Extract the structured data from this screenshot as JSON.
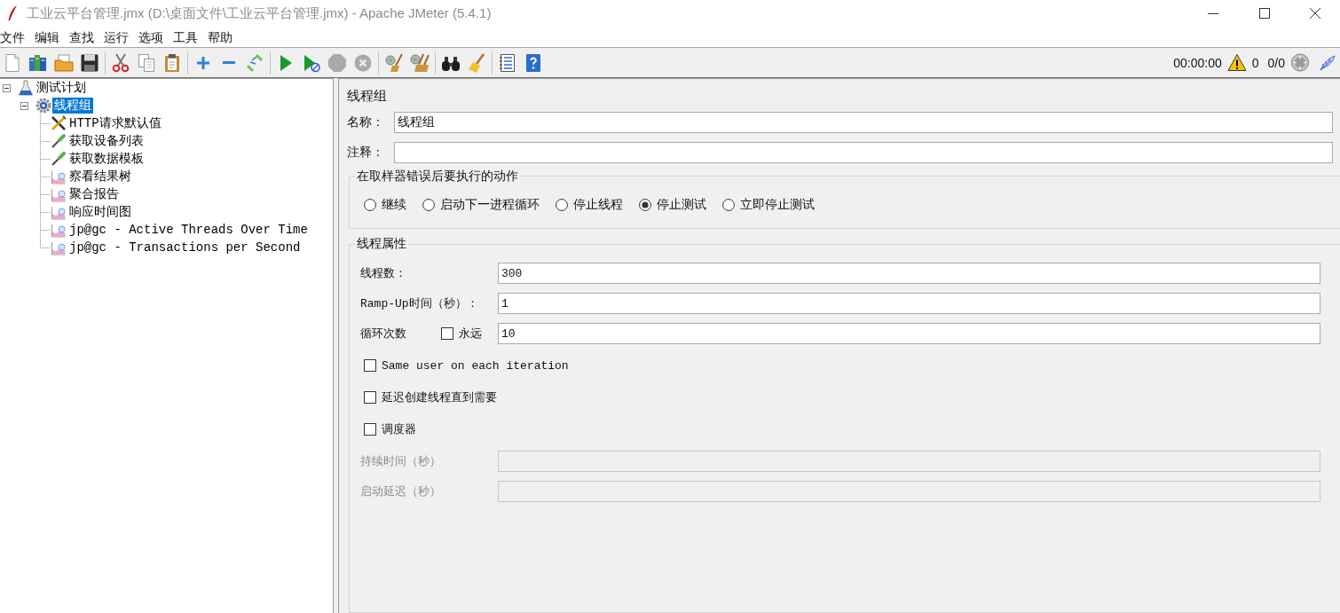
{
  "window": {
    "title": "工业云平台管理.jmx (D:\\桌面文件\\工业云平台管理.jmx) - Apache JMeter (5.4.1)"
  },
  "menu": [
    "文件",
    "编辑",
    "查找",
    "运行",
    "选项",
    "工具",
    "帮助"
  ],
  "toolbar": {
    "stop_disabled": true
  },
  "status": {
    "elapsed": "00:00:00",
    "errors": "0",
    "threads": "0/0"
  },
  "tree": [
    {
      "label": "测试计划",
      "kind": "plan",
      "expanded": true,
      "selected": false,
      "children": [
        {
          "label": "线程组",
          "kind": "thread_group",
          "expanded": true,
          "selected": true,
          "children": [
            {
              "label": "HTTP请求默认值",
              "kind": "config",
              "selected": false
            },
            {
              "label": "获取设备列表",
              "kind": "sampler",
              "selected": false
            },
            {
              "label": "获取数据模板",
              "kind": "sampler",
              "selected": false
            },
            {
              "label": "察看结果树",
              "kind": "listener",
              "selected": false
            },
            {
              "label": "聚合报告",
              "kind": "listener",
              "selected": false
            },
            {
              "label": "响应时间图",
              "kind": "listener",
              "selected": false
            },
            {
              "label": "jp@gc - Active Threads Over Time",
              "kind": "listener",
              "selected": false
            },
            {
              "label": "jp@gc - Transactions per Second",
              "kind": "listener",
              "selected": false
            }
          ]
        }
      ]
    }
  ],
  "editor": {
    "title": "线程组",
    "name": {
      "label": "名称：",
      "value": "线程组"
    },
    "comment": {
      "label": "注释："
    },
    "on_error": {
      "title": "在取样器错误后要执行的动作",
      "options": [
        {
          "label": "继续",
          "selected": false
        },
        {
          "label": "启动下一进程循环",
          "selected": false
        },
        {
          "label": "停止线程",
          "selected": false
        },
        {
          "label": "停止测试",
          "selected": true
        },
        {
          "label": "立即停止测试",
          "selected": false
        }
      ]
    },
    "thread_properties": {
      "title": "线程属性",
      "threads": {
        "label": "线程数：",
        "value": "300"
      },
      "ramp_up": {
        "label": "Ramp-Up时间（秒）：",
        "value": "1"
      },
      "loop": {
        "label": "循环次数",
        "forever_label": "永远",
        "forever_checked": false,
        "value": "10"
      },
      "options": [
        {
          "label": "Same user on each iteration",
          "checked": false
        },
        {
          "label": "延迟创建线程直到需要",
          "checked": false
        },
        {
          "label": "调度器",
          "checked": false
        }
      ],
      "duration": {
        "label": "持续时间（秒）",
        "disabled": true
      },
      "startup_delay": {
        "label": "启动延迟（秒）",
        "disabled": true
      }
    }
  }
}
